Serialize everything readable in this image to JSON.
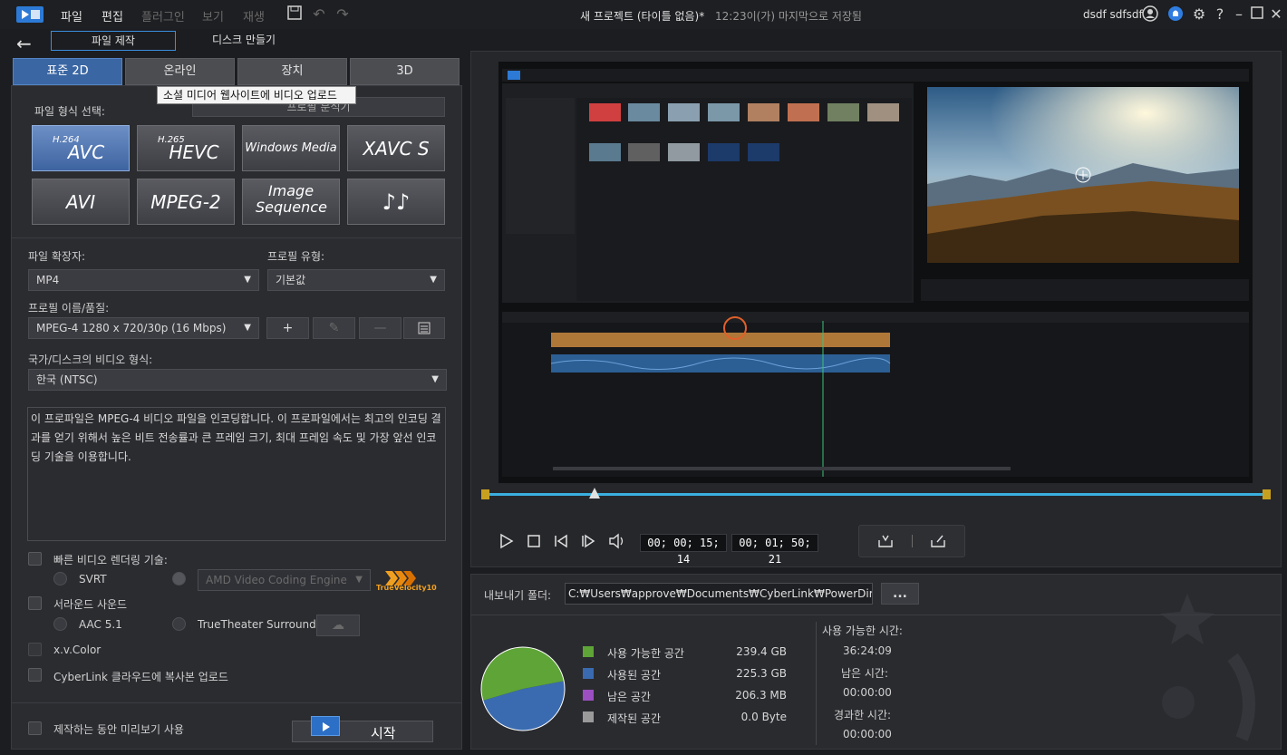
{
  "titlebar": {
    "menus": [
      "파일",
      "편집",
      "플러그인",
      "보기",
      "재생"
    ],
    "title": "새 프로젝트 (타이틀 없음)*",
    "saved_time": "12:23이(가) 마지막으로 저장됨",
    "user": "dsdf sdfsdf",
    "help": "?"
  },
  "mode_tabs": {
    "file": "파일 제작",
    "disc": "디스크 만들기"
  },
  "category_tabs": [
    "표준 2D",
    "온라인",
    "장치",
    "3D"
  ],
  "tooltip": "소셜 미디어 웹사이트에 비디오 업로드",
  "format": {
    "title": "파일 형식 선택:",
    "profile_analyzer": "프로필 분석기",
    "buttons": [
      {
        "sup": "H.264",
        "main": "AVC"
      },
      {
        "sup": "H.265",
        "main": "HEVC"
      },
      {
        "sup": "",
        "main": "Windows Media"
      },
      {
        "sup": "",
        "main": "XAVC S"
      },
      {
        "sup": "",
        "main": "AVI"
      },
      {
        "sup": "",
        "main": "MPEG-2"
      },
      {
        "sup": "",
        "main": "Image Sequence"
      },
      {
        "sup": "",
        "main": "♪♪"
      }
    ]
  },
  "settings": {
    "ext_label": "파일 확장자:",
    "ext_value": "MP4",
    "profile_type_label": "프로필 유형:",
    "profile_type_value": "기본값",
    "profile_name_label": "프로필 이름/품질:",
    "profile_name_value": "MPEG-4 1280 x 720/30p (16 Mbps)",
    "country_label": "국가/디스크의 비디오 형식:",
    "country_value": "한국 (NTSC)",
    "description": "이 프로파일은 MPEG-4 비디오 파일을 인코딩합니다. 이 프로파일에서는 최고의 인코딩 결과를 얻기 위해서 높은 비트 전송률과 큰 프레임 크기, 최대 프레임 속도 및 가장 앞선 인코딩 기술을 이용합니다."
  },
  "options": {
    "fast_render": "빠른 비디오 렌더링 기술:",
    "svrt": "SVRT",
    "amd": "AMD Video Coding Engine",
    "surround": "서라운드 사운드",
    "aac": "AAC 5.1",
    "truetheater": "TrueTheater Surround",
    "xvcolor": "x.v.Color",
    "cloud": "CyberLink 클라우드에 복사본 업로드",
    "preview_during": "제작하는 동안 미리보기 사용",
    "start": "시작",
    "truevelocity": "TrueVelocity10"
  },
  "playback": {
    "current_tc": "00; 00; 15; 14",
    "total_tc": "00; 01; 50; 21"
  },
  "export": {
    "folder_label": "내보내기 폴더:",
    "folder_path": "C:₩Users₩approve₩Documents₩CyberLink₩PowerDirector₩P",
    "more": "...",
    "legend": [
      {
        "label": "사용 가능한 공간",
        "value": "239.4  GB",
        "color": "#5ea437"
      },
      {
        "label": "사용된 공간",
        "value": "225.3  GB",
        "color": "#3a6bb0"
      },
      {
        "label": "남은 공간",
        "value": "206.3  MB",
        "color": "#9b4fc0"
      },
      {
        "label": "제작된 공간",
        "value": "0.0  Byte",
        "color": "#9a9a9a"
      }
    ],
    "avail_time_label": "사용 가능한 시간:",
    "avail_time": "36:24:09",
    "remaining_label": "남은 시간:",
    "remaining": "00:00:00",
    "elapsed_label": "경과한 시간:",
    "elapsed": "00:00:00"
  }
}
